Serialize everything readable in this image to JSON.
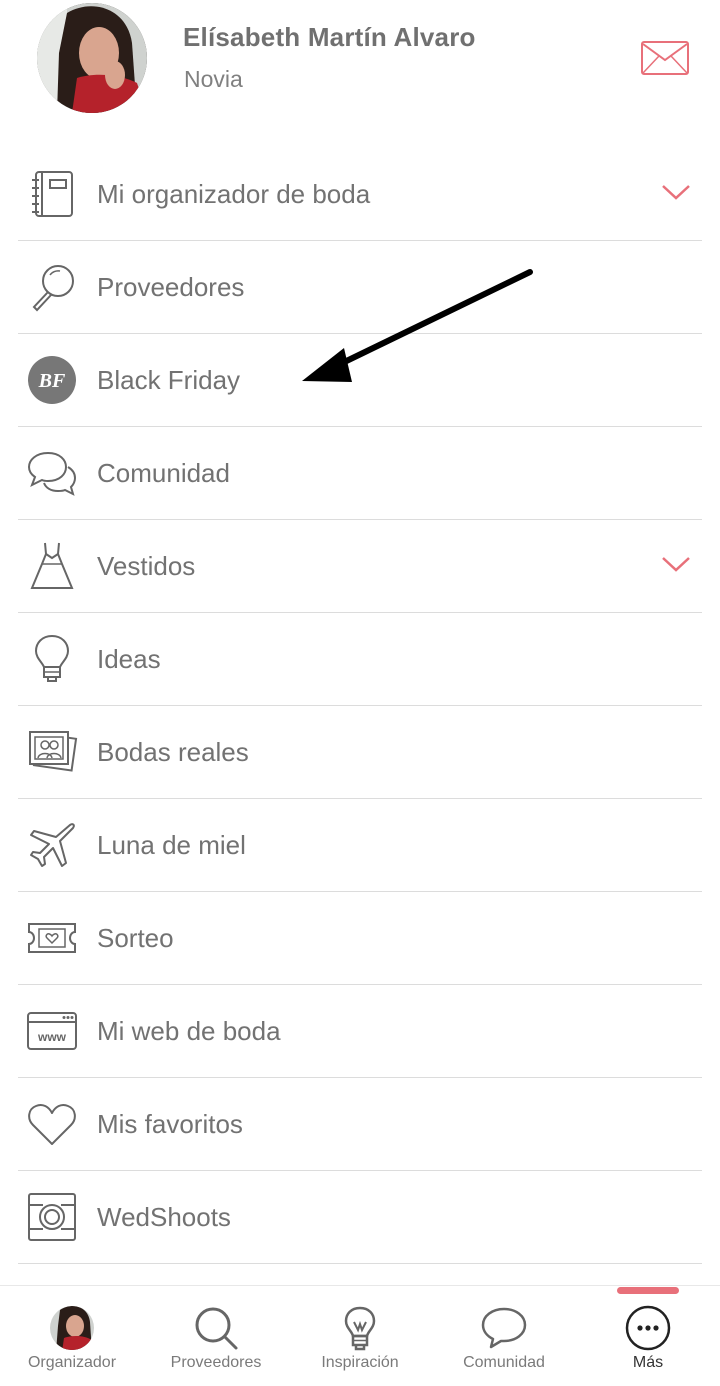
{
  "profile": {
    "name": "Elísabeth Martín Alvaro",
    "role": "Novia"
  },
  "menu": {
    "items": [
      {
        "label": "Mi organizador de boda",
        "icon": "notebook-icon",
        "expandable": true
      },
      {
        "label": "Proveedores",
        "icon": "magnifier-icon",
        "expandable": false
      },
      {
        "label": "Black Friday",
        "icon": "black-friday-badge-icon",
        "badge_text": "BF",
        "expandable": false
      },
      {
        "label": "Comunidad",
        "icon": "chat-bubbles-icon",
        "expandable": false
      },
      {
        "label": "Vestidos",
        "icon": "dress-icon",
        "expandable": true
      },
      {
        "label": "Ideas",
        "icon": "lightbulb-icon",
        "expandable": false
      },
      {
        "label": "Bodas reales",
        "icon": "photos-icon",
        "expandable": false
      },
      {
        "label": "Luna de miel",
        "icon": "airplane-icon",
        "expandable": false
      },
      {
        "label": "Sorteo",
        "icon": "ticket-icon",
        "expandable": false
      },
      {
        "label": "Mi web de boda",
        "icon": "browser-www-icon",
        "badge_text": "www",
        "expandable": false
      },
      {
        "label": "Mis favoritos",
        "icon": "heart-icon",
        "expandable": false
      },
      {
        "label": "WedShoots",
        "icon": "camera-icon",
        "expandable": false
      }
    ]
  },
  "bottom_nav": {
    "items": [
      {
        "label": "Organizador",
        "icon": "avatar-icon"
      },
      {
        "label": "Proveedores",
        "icon": "search-icon"
      },
      {
        "label": "Inspiración",
        "icon": "lightbulb-icon"
      },
      {
        "label": "Comunidad",
        "icon": "chat-icon"
      },
      {
        "label": "Más",
        "icon": "more-icon",
        "active": true
      }
    ]
  },
  "colors": {
    "accent": "#e8707a",
    "text": "#727272",
    "icon": "#666666",
    "divider": "#dcdcdc",
    "badge_bg": "#777777"
  }
}
